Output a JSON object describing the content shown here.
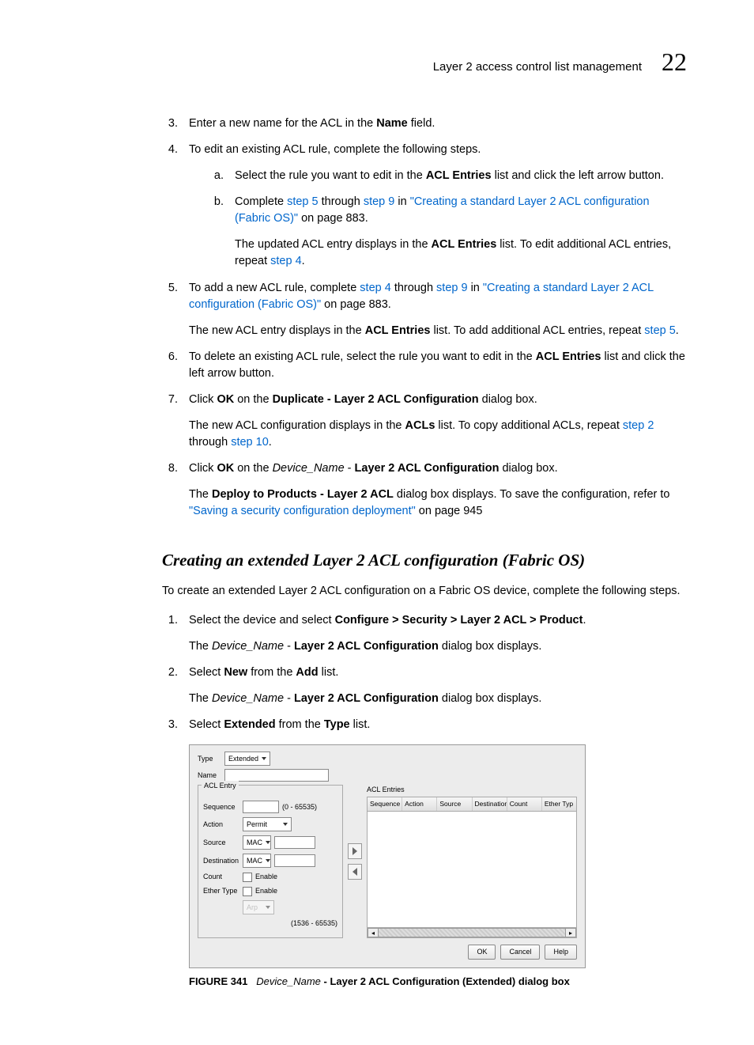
{
  "header": {
    "title": "Layer 2 access control list management",
    "chapter": "22"
  },
  "steps": {
    "s3": {
      "num": "3.",
      "pre": "Enter a new name for the ACL in the ",
      "bold": "Name",
      "post": " field."
    },
    "s4": {
      "num": "4.",
      "text": "To edit an existing ACL rule, complete the following steps.",
      "a": {
        "marker": "a.",
        "pre": "Select the rule you want to edit in the ",
        "bold": "ACL Entries",
        "post": " list and click the left arrow button."
      },
      "b": {
        "marker": "b.",
        "t1": "Complete ",
        "l1": "step 5",
        "t2": " through ",
        "l2": "step 9",
        "t3": " in ",
        "l3": "\"Creating a standard Layer 2 ACL configuration (Fabric OS)\"",
        "t4": " on page 883.",
        "f1a": "The updated ACL entry displays in the ",
        "f1b": "ACL Entries",
        "f1c": " list. To edit additional ACL entries, repeat ",
        "f1d": "step 4",
        "f1e": "."
      }
    },
    "s5": {
      "num": "5.",
      "t1": "To add a new ACL rule, complete ",
      "l1": "step 4",
      "t2": " through ",
      "l2": "step 9",
      "t3": " in ",
      "l3": "\"Creating a standard Layer 2 ACL configuration (Fabric OS)\"",
      "t4": " on page 883.",
      "f1a": "The new ACL entry displays in the ",
      "f1b": "ACL Entries",
      "f1c": " list. To add additional ACL entries, repeat ",
      "f1d": "step 5",
      "f1e": "."
    },
    "s6": {
      "num": "6.",
      "pre": "To delete an existing ACL rule, select the rule you want to edit in the ",
      "bold": "ACL Entries",
      "post": " list and click the left arrow button."
    },
    "s7": {
      "num": "7.",
      "t1": "Click ",
      "b1": "OK",
      "t2": " on the ",
      "b2": "Duplicate - Layer 2 ACL Configuration",
      "t3": " dialog box.",
      "f1a": "The new ACL configuration displays in the ",
      "f1b": "ACLs",
      "f1c": " list. To copy additional ACLs, repeat ",
      "f1d": "step 2",
      "f1e": " through ",
      "f1f": "step 10",
      "f1g": "."
    },
    "s8": {
      "num": "8.",
      "t1": "Click ",
      "b1": "OK",
      "t2": " on the ",
      "it1": "Device_Name",
      "t3": " - ",
      "b2": "Layer 2 ACL Configuration",
      "t4": " dialog box.",
      "f1a": "The ",
      "f1b": "Deploy to Products - Layer 2 ACL",
      "f1c": " dialog box displays. To save the configuration, refer to ",
      "f1d": "\"Saving a security configuration deployment\"",
      "f1e": " on page 945"
    }
  },
  "section2": {
    "heading": "Creating an extended Layer 2 ACL configuration (Fabric OS)",
    "intro": "To create an extended Layer 2 ACL configuration on a Fabric OS device, complete the following steps.",
    "s1": {
      "num": "1.",
      "t1": "Select the device and select ",
      "b1": "Configure > Security > Layer 2 ACL > Product",
      "t2": ".",
      "fa": "The ",
      "fit": "Device_Name",
      "fb": " - ",
      "fbold": "Layer 2 ACL Configuration",
      "fc": " dialog box displays."
    },
    "s2": {
      "num": "2.",
      "t1": "Select ",
      "b1": "New",
      "t2": " from the ",
      "b2": "Add",
      "t3": " list.",
      "fa": "The ",
      "fit": "Device_Name",
      "fb": " - ",
      "fbold": "Layer 2 ACL Configuration",
      "fc": " dialog box displays."
    },
    "s3": {
      "num": "3.",
      "t1": "Select ",
      "b1": "Extended",
      "t2": " from the ",
      "b2": "Type",
      "t3": " list."
    }
  },
  "dialog": {
    "typeLabel": "Type",
    "typeValue": "Extended",
    "nameLabel": "Name",
    "leftTitle": "ACL Entry",
    "seqLabel": "Sequence",
    "seqHint": "(0 - 65535)",
    "actionLabel": "Action",
    "actionValue": "Permit",
    "sourceLabel": "Source",
    "sourceValue": "MAC",
    "destLabel": "Destination",
    "destValue": "MAC",
    "countLabel": "Count",
    "countEnable": "Enable",
    "etherLabel": "Ether Type",
    "etherEnable": "Enable",
    "etherOpt": "Arp",
    "etherHint": "(1536 - 65535)",
    "rightTitle": "ACL Entries",
    "cols": [
      "Sequence",
      "Action",
      "Source",
      "Destination",
      "Count",
      "Ether Typ"
    ],
    "ok": "OK",
    "cancel": "Cancel",
    "help": "Help"
  },
  "figure": {
    "label": "FIGURE 341",
    "it": "Device_Name",
    "rest": " - Layer 2 ACL Configuration (Extended) dialog box"
  }
}
